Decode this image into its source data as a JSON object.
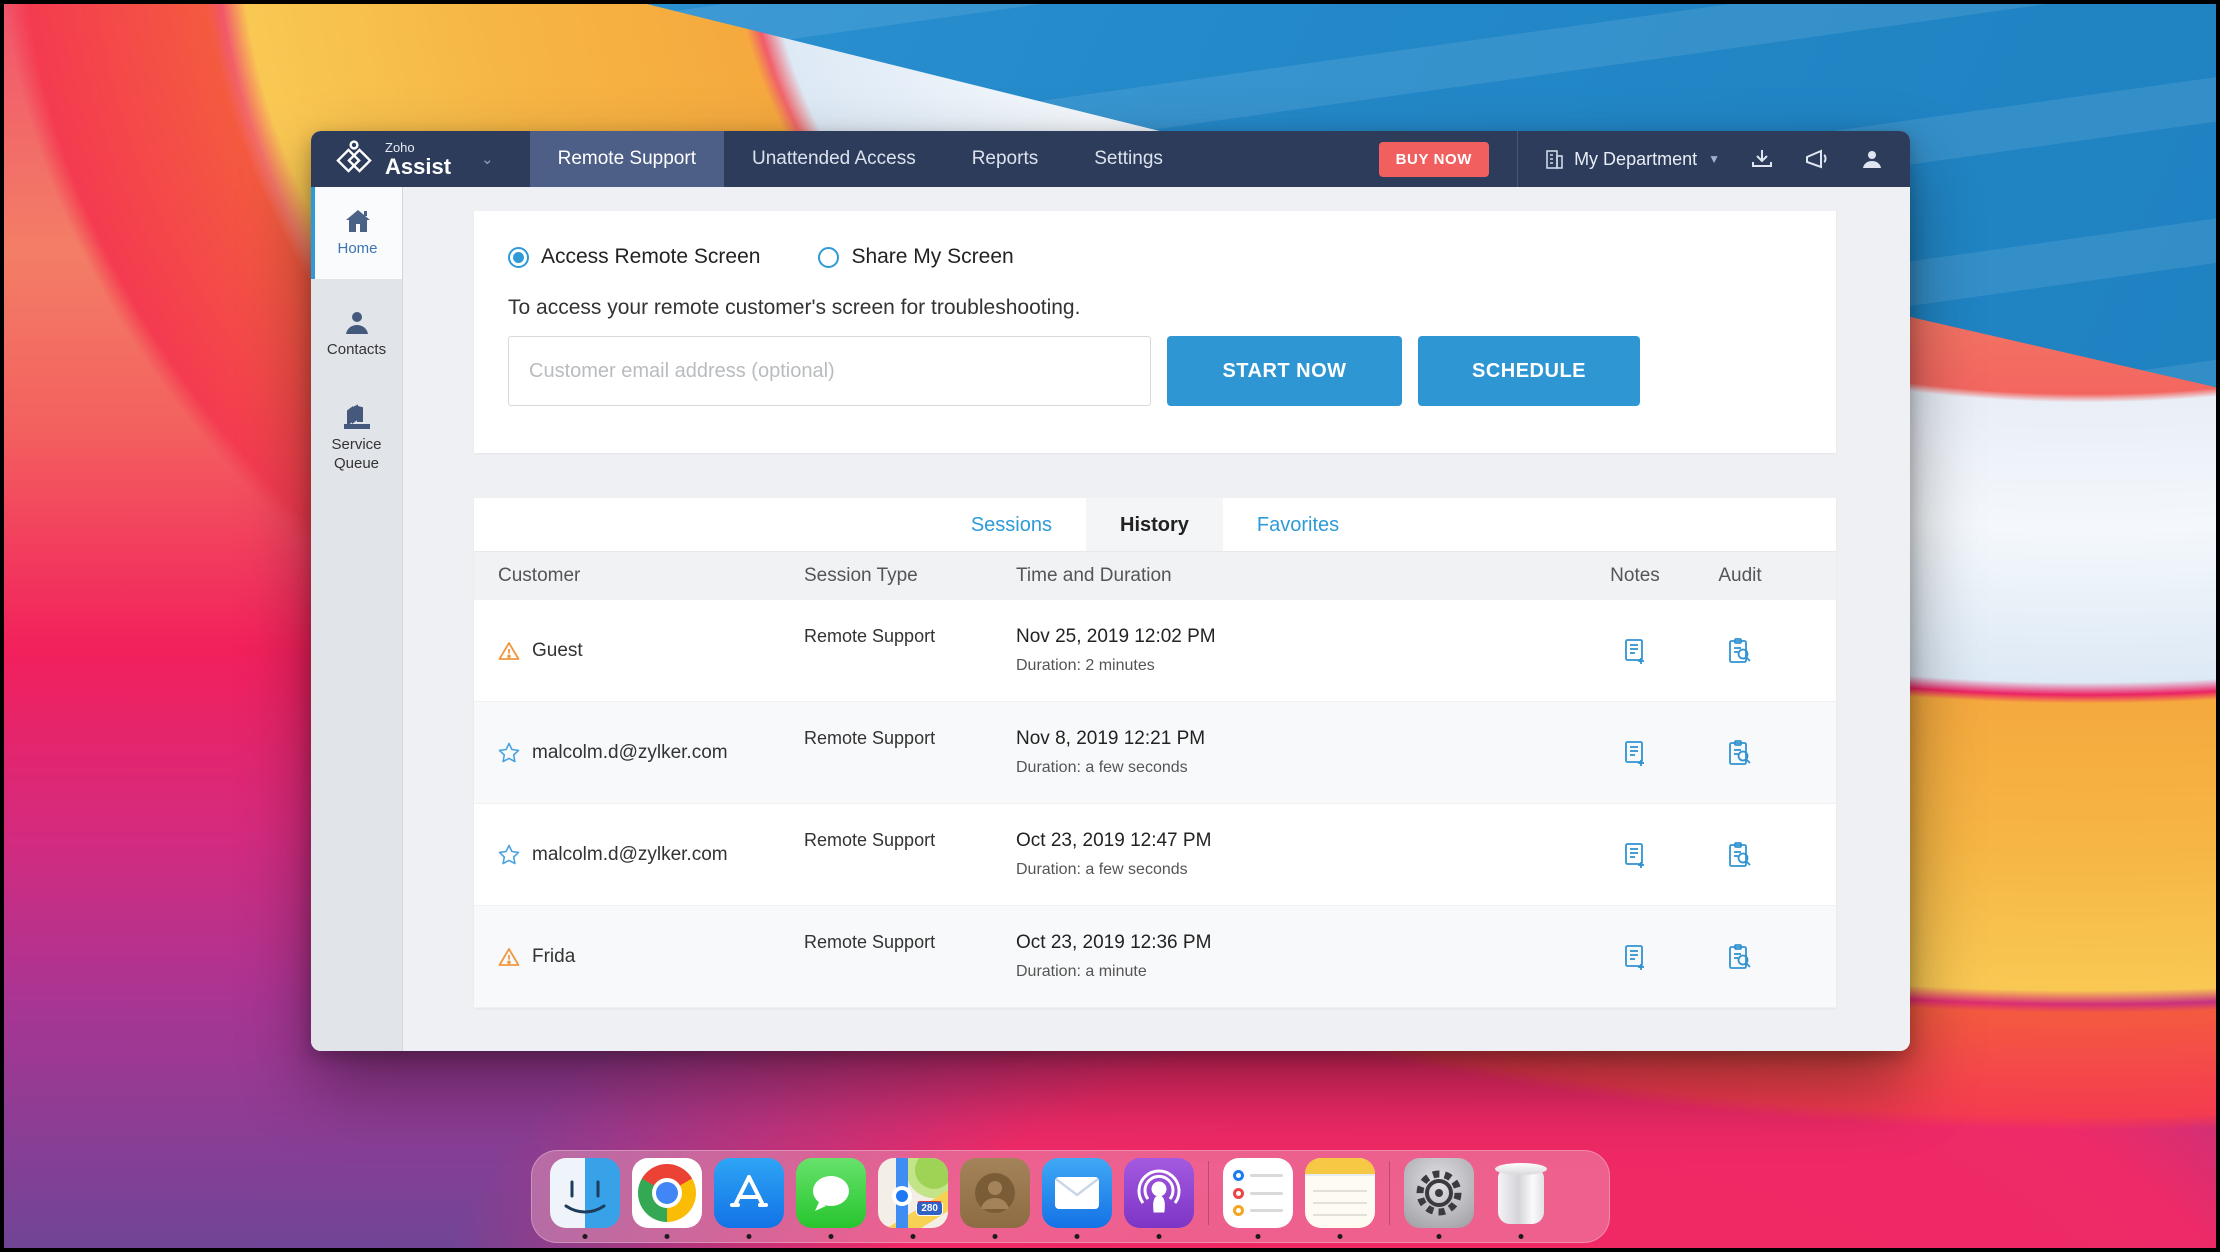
{
  "navbar": {
    "brand_top": "Zoho",
    "brand_bottom": "Assist",
    "tabs": [
      {
        "label": "Remote Support",
        "active": true
      },
      {
        "label": "Unattended Access",
        "active": false
      },
      {
        "label": "Reports",
        "active": false
      },
      {
        "label": "Settings",
        "active": false
      }
    ],
    "buy_now": "BUY NOW",
    "department": "My Department"
  },
  "sidebar": {
    "items": [
      {
        "label": "Home",
        "icon": "home-icon",
        "active": true
      },
      {
        "label": "Contacts",
        "icon": "contacts-icon",
        "active": false
      },
      {
        "label": "Service Queue",
        "icon": "service-queue-icon",
        "active": false
      }
    ]
  },
  "session_panel": {
    "radio_access": "Access Remote Screen",
    "radio_share": "Share My Screen",
    "selected_radio": "Access Remote Screen",
    "description": "To access your remote customer's screen for troubleshooting.",
    "email_placeholder": "Customer email address (optional)",
    "start_button": "START NOW",
    "schedule_button": "SCHEDULE"
  },
  "history_panel": {
    "tabs": [
      {
        "label": "Sessions",
        "active": false
      },
      {
        "label": "History",
        "active": true
      },
      {
        "label": "Favorites",
        "active": false
      }
    ],
    "columns": [
      "Customer",
      "Session Type",
      "Time and Duration",
      "Notes",
      "Audit"
    ],
    "rows": [
      {
        "icon": "warning-icon",
        "customer": "Guest",
        "type": "Remote Support",
        "time": "Nov 25, 2019 12:02 PM",
        "duration": "Duration: 2 minutes"
      },
      {
        "icon": "star-icon",
        "customer": "malcolm.d@zylker.com",
        "type": "Remote Support",
        "time": "Nov 8, 2019 12:21 PM",
        "duration": "Duration: a few seconds"
      },
      {
        "icon": "star-icon",
        "customer": "malcolm.d@zylker.com",
        "type": "Remote Support",
        "time": "Oct 23, 2019 12:47 PM",
        "duration": "Duration: a few seconds"
      },
      {
        "icon": "warning-icon",
        "customer": "Frida",
        "type": "Remote Support",
        "time": "Oct 23, 2019 12:36 PM",
        "duration": "Duration: a minute"
      }
    ]
  },
  "dock": {
    "apps": [
      "finder",
      "chrome",
      "app-store",
      "messages",
      "maps",
      "contacts",
      "mail",
      "podcasts",
      "reminders",
      "notes",
      "system-preferences",
      "trash"
    ],
    "maps_badge": "280"
  },
  "colors": {
    "accent_blue": "#2e9ad8",
    "navbar_bg": "#2d3c5a",
    "buy_now_red": "#f15f5f",
    "warning_orange": "#f0983f",
    "button_blue": "#2f96d4"
  }
}
